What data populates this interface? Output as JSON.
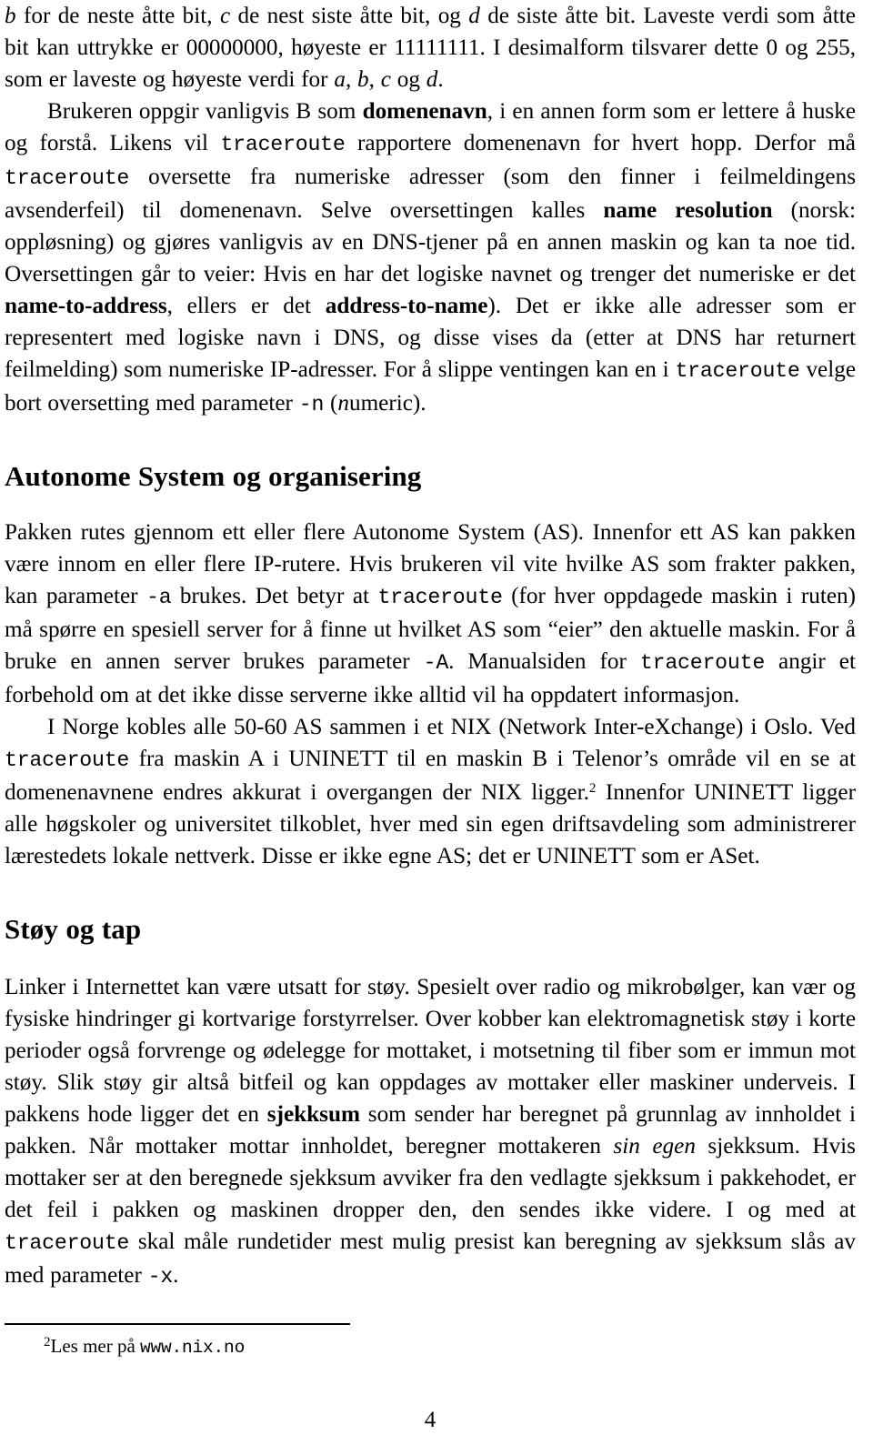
{
  "document": {
    "language": "no",
    "page_number": "4"
  },
  "paragraphs": {
    "p1": {
      "segments": [
        {
          "text": "b",
          "style": "it"
        },
        {
          "text": " for de neste åtte bit, ",
          "style": "rm"
        },
        {
          "text": "c",
          "style": "it"
        },
        {
          "text": " de nest siste åtte bit, og ",
          "style": "rm"
        },
        {
          "text": "d",
          "style": "it"
        },
        {
          "text": " de siste åtte bit. Laveste verdi som åtte bit kan uttrykke er 00000000, høyeste er 11111111. I desimalform tilsvarer dette 0 og 255, som er laveste og høyeste verdi for ",
          "style": "rm"
        },
        {
          "text": "a",
          "style": "it"
        },
        {
          "text": ", ",
          "style": "rm"
        },
        {
          "text": "b",
          "style": "it"
        },
        {
          "text": ", ",
          "style": "rm"
        },
        {
          "text": "c",
          "style": "it"
        },
        {
          "text": " og ",
          "style": "rm"
        },
        {
          "text": "d",
          "style": "it"
        },
        {
          "text": ".",
          "style": "rm"
        }
      ]
    },
    "p2": {
      "segments": [
        {
          "text": "Brukeren oppgir vanligvis B som ",
          "style": "rm"
        },
        {
          "text": "domenenavn",
          "style": "bf"
        },
        {
          "text": ", i en annen form som er lettere å huske og forstå. Likens vil ",
          "style": "rm"
        },
        {
          "text": "traceroute",
          "style": "tt"
        },
        {
          "text": " rapportere domenenavn for hvert hopp. Derfor må ",
          "style": "rm"
        },
        {
          "text": "traceroute",
          "style": "tt"
        },
        {
          "text": " oversette fra numeriske adresser (som den finner i feilmeldingens avsenderfeil) til domenenavn. Selve oversettingen kalles ",
          "style": "rm"
        },
        {
          "text": "name resolution",
          "style": "bf"
        },
        {
          "text": " (norsk: oppløsning) og gjøres vanligvis av en DNS-tjener på en annen maskin og kan ta noe tid. Oversettingen går to veier: Hvis en har det logiske navnet og trenger det numeriske er det ",
          "style": "rm"
        },
        {
          "text": "name-to-address",
          "style": "bf"
        },
        {
          "text": ", ellers er det ",
          "style": "rm"
        },
        {
          "text": "address-to-name",
          "style": "bf"
        },
        {
          "text": "). Det er ikke alle adresser som er representert med logiske navn i DNS, og disse vises da (etter at DNS har returnert feilmelding) som numeriske IP-adresser. For å slippe ventingen kan en i ",
          "style": "rm"
        },
        {
          "text": "traceroute",
          "style": "tt"
        },
        {
          "text": " velge bort oversetting med parameter ",
          "style": "rm"
        },
        {
          "text": "-n",
          "style": "tt"
        },
        {
          "text": " (",
          "style": "rm"
        },
        {
          "text": "n",
          "style": "it"
        },
        {
          "text": "umeric).",
          "style": "rm"
        }
      ]
    },
    "p3": {
      "segments": [
        {
          "text": "Pakken rutes gjennom ett eller flere Autonome System (AS). Innenfor ett AS kan pakken være innom en eller flere IP-rutere. Hvis brukeren vil vite hvilke AS som frakter pakken, kan parameter ",
          "style": "rm"
        },
        {
          "text": "-a",
          "style": "tt"
        },
        {
          "text": " brukes. Det betyr at ",
          "style": "rm"
        },
        {
          "text": "traceroute",
          "style": "tt"
        },
        {
          "text": " (for hver oppdagede maskin i ruten) må spørre en spesiell server for å finne ut hvilket AS som “eier” den aktuelle maskin. For å bruke en annen server brukes parameter ",
          "style": "rm"
        },
        {
          "text": "-A",
          "style": "tt"
        },
        {
          "text": ". Manualsiden for ",
          "style": "rm"
        },
        {
          "text": "traceroute",
          "style": "tt"
        },
        {
          "text": " angir et forbehold om at det ikke disse serverne ikke alltid vil ha oppdatert informasjon.",
          "style": "rm"
        }
      ]
    },
    "p4": {
      "segments": [
        {
          "text": "I Norge kobles alle 50-60 AS sammen i et NIX (Network Inter-eXchange) i Oslo. Ved ",
          "style": "rm"
        },
        {
          "text": "traceroute",
          "style": "tt"
        },
        {
          "text": " fra maskin A i UNINETT til en maskin B i Telenor’s område vil en se at domenenavnene endres akkurat i overgangen der NIX ligger.",
          "style": "rm"
        },
        {
          "text": "2",
          "style": "sup"
        },
        {
          "text": " Innenfor UNINETT ligger alle høgskoler og universitet tilkoblet, hver med sin egen driftsavdeling som administrerer lærestedets lokale nettverk. Disse er ikke egne AS; det er UNINETT som er ASet.",
          "style": "rm"
        }
      ]
    },
    "p5": {
      "segments": [
        {
          "text": "Linker i Internettet kan være utsatt for støy. Spesielt over radio og mikrobølger, kan vær og fysiske hindringer gi kortvarige forstyrrelser. Over kobber kan elektromagnetisk støy i korte perioder også forvrenge og ødelegge for mottaket, i motsetning til fiber som er immun mot støy. Slik støy gir altså bitfeil og kan oppdages av mottaker eller maskiner underveis. I pakkens hode ligger det en ",
          "style": "rm"
        },
        {
          "text": "sjekksum",
          "style": "bf"
        },
        {
          "text": " som sender har beregnet på grunnlag av innholdet i pakken. Når mottaker mottar innholdet, beregner mottakeren ",
          "style": "rm"
        },
        {
          "text": "sin egen",
          "style": "it"
        },
        {
          "text": " sjekksum. Hvis mottaker ser at den beregnede sjekksum avviker fra den vedlagte sjekksum i pakkehodet, er det feil i pakken og maskinen dropper den, den sendes ikke videre. I og med at ",
          "style": "rm"
        },
        {
          "text": "traceroute",
          "style": "tt"
        },
        {
          "text": " skal måle rundetider mest mulig presist kan beregning av sjekksum slås av med parameter ",
          "style": "rm"
        },
        {
          "text": "-x",
          "style": "tt"
        },
        {
          "text": ".",
          "style": "rm"
        }
      ]
    }
  },
  "headings": {
    "autonome": "Autonome System og organisering",
    "stoy": "Støy og tap"
  },
  "footnote": {
    "marker": "2",
    "text_before": "Les mer på ",
    "url": "www.nix.no"
  }
}
